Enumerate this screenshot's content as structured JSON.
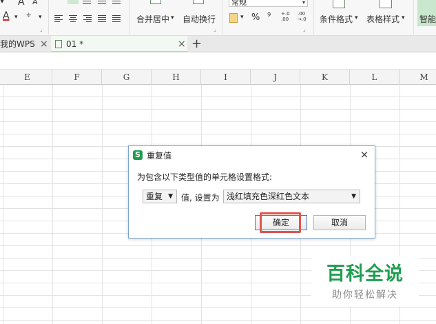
{
  "ribbon": {
    "font_a_large": "A",
    "font_a_small": "A",
    "font_color_letter": "A",
    "merge_center": "合并居中",
    "wrap_text": "自动换行",
    "number_format": "常规",
    "percent": "%",
    "thousand": "⁹",
    "inc_decimal": "+.0\n.00",
    "dec_decimal": ".00\n→.0",
    "conditional_format": "条件格式",
    "table_style": "表格样式",
    "smart": "智能",
    "dropdown_caret": "▾",
    "corner_glyph": "⌟"
  },
  "tabs": {
    "my_wps": "我的WPS",
    "document": "01 *",
    "close_glyph": "×",
    "add_glyph": "+"
  },
  "columns": [
    "E",
    "F",
    "G",
    "H",
    "I",
    "J",
    "K",
    "L",
    "M"
  ],
  "dialog": {
    "title": "重复值",
    "logo_letter": "S",
    "close_glyph": "×",
    "prompt": "为包含以下类型值的单元格设置格式:",
    "type_value": "重复",
    "middle_text": "值, 设置为",
    "format_value": "浅红填充色深红色文本",
    "arrow_glyph": "▼",
    "ok_label": "确定",
    "cancel_label": "取消"
  },
  "watermark": {
    "title": "百科全说",
    "subtitle": "助你轻松解决"
  },
  "colors": {
    "accent_green": "#1e9e4f",
    "dialog_border": "#7aa4cf",
    "highlight_red": "#e0534f",
    "font_color_red": "#e02020"
  }
}
